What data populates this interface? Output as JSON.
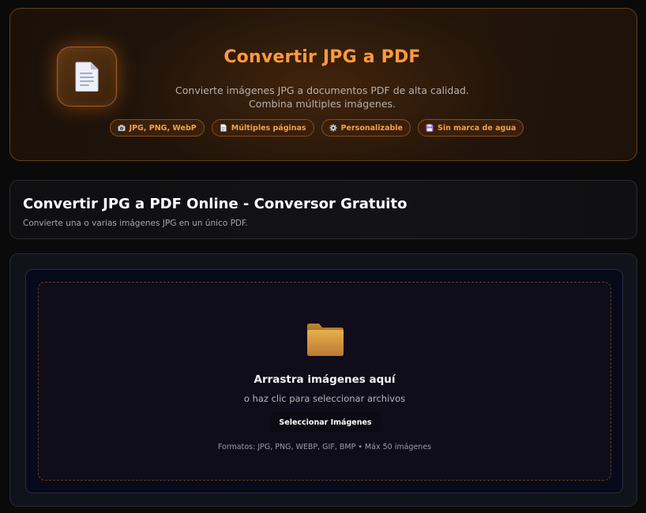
{
  "hero": {
    "title": "Convertir JPG a PDF",
    "description_line1": "Convierte imágenes JPG a documentos PDF de alta calidad.",
    "description_line2": "Combina múltiples imágenes.",
    "icon": "document-icon",
    "badges": [
      {
        "icon": "camera-icon",
        "label": "JPG, PNG, WebP"
      },
      {
        "icon": "page-icon",
        "label": "Múltiples páginas"
      },
      {
        "icon": "gear-icon",
        "label": "Personalizable"
      },
      {
        "icon": "floppy-disk-icon",
        "label": "Sin marca de agua"
      }
    ],
    "colors": {
      "accent": "#ff9a3c",
      "badge_text": "#f0a04c",
      "border": "#6a3f14"
    }
  },
  "info": {
    "title": "Convertir JPG a PDF Online - Conversor Gratuito",
    "subtitle": "Convierte una o varias imágenes JPG en un único PDF."
  },
  "upload": {
    "icon": "folder-icon",
    "title": "Arrastra imágenes aquí",
    "subtitle": "o haz clic para seleccionar archivos",
    "button_label": "Seleccionar Imágenes",
    "formats": "Formatos: JPG, PNG, WEBP, GIF, BMP • Máx 50 imágenes"
  }
}
